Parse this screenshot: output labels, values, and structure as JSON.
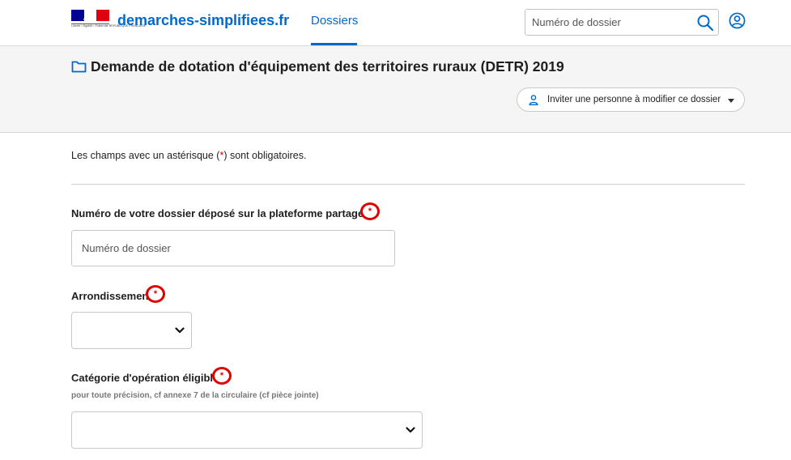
{
  "header": {
    "logo_text": "Liberté • Égalité • Fraternité RÉPUBLIQUE FRANÇAISE",
    "site_name": "demarches-simplifiees.fr",
    "nav_dossiers": "Dossiers",
    "search_placeholder": "Numéro de dossier",
    "brand_color": "#0069cc"
  },
  "subheader": {
    "title": "Demande de dotation d'équipement des territoires ruraux (DETR) 2019",
    "invite_label": "Inviter une personne à modifier ce dossier"
  },
  "form": {
    "notice_prefix": "Les champs avec un astérisque (",
    "notice_star": "*",
    "notice_suffix": ") sont obligatoires.",
    "asterisk": "*",
    "fields": [
      {
        "label": "Numéro de votre dossier déposé sur la plateforme partagé",
        "placeholder": "Numéro de dossier"
      },
      {
        "label": "Arrondissemen",
        "value": ""
      },
      {
        "label": "Catégorie d'opération éligibl",
        "hint": "pour toute précision, cf annexe 7 de la circulaire (cf pièce jointe)",
        "value": ""
      }
    ]
  },
  "colors": {
    "required_marker": "#e00000",
    "subheader_bg": "#f5f5f5"
  }
}
